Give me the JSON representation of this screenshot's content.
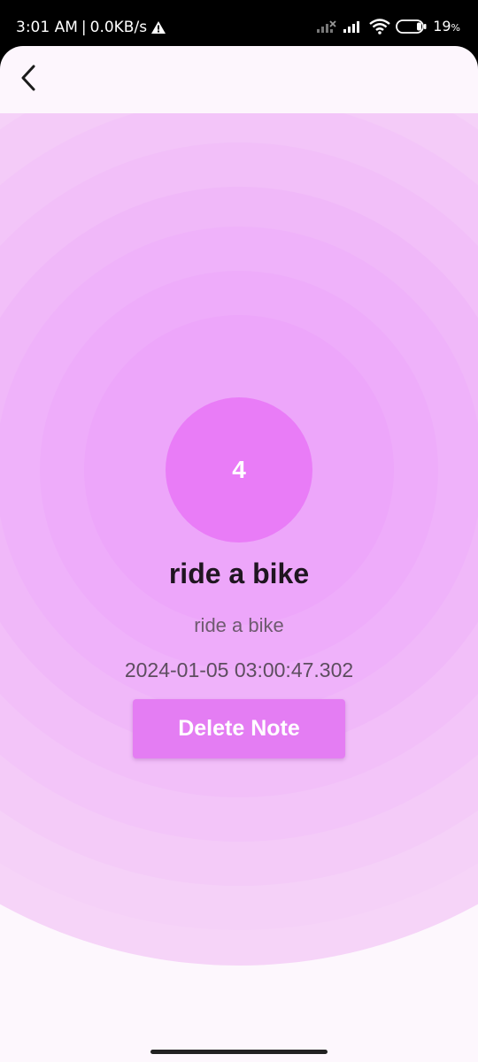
{
  "status_bar": {
    "time": "3:01 AM",
    "separator": "|",
    "network_speed": "0.0KB/s",
    "alert_icon": "warning-icon",
    "battery_percent": "19",
    "battery_unit": "%",
    "icons": [
      "signal-off-icon",
      "signal-icon",
      "wifi-icon",
      "battery-icon"
    ]
  },
  "app_bar": {
    "back_icon": "chevron-left-icon"
  },
  "note": {
    "index": "4",
    "title": "ride a bike",
    "description": "ride a bike",
    "timestamp": "2024-01-05 03:00:47.302"
  },
  "actions": {
    "delete_label": "Delete Note"
  },
  "colors": {
    "accent": "#e47df3",
    "avatar": "#e97cf7",
    "background": "#fdf7fd"
  }
}
